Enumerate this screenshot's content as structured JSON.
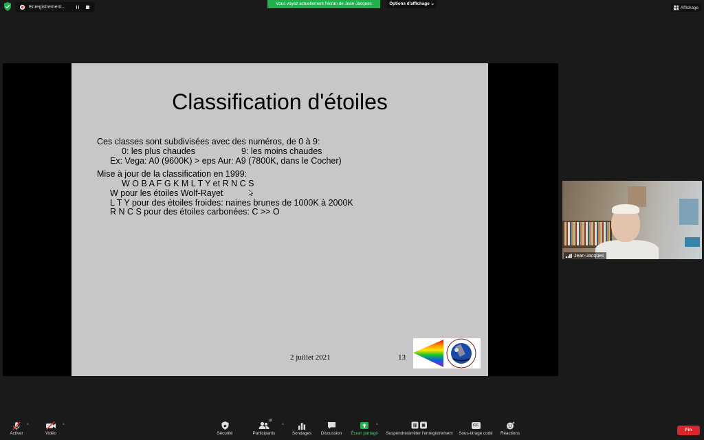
{
  "top_bar": {
    "recording_label": "Enregistrement...",
    "share_banner": "Vous voyez actuellement l'écran de Jean-Jacques",
    "view_options": "Options d'affichage",
    "view_options_caret": "⌄",
    "display_button": "Affichage"
  },
  "slide": {
    "title": "Classification d'étoiles",
    "lines": [
      "Ces classes sont subdivisées avec des numéros, de 0 à 9:",
      "0:  les plus chaudes",
      "9:  les moins chaudes",
      "Ex: Vega: A0 (9600K) > eps Aur: A9 (7800K, dans le Cocher)",
      "Mise à jour de la classification en 1999:",
      "W O B A F G K M L T Y   et R N C S",
      "W pour les étoiles Wolf-Rayet",
      "L T Y pour des étoiles froides: naines brunes de 1000K à 2000K",
      "R N C S pour des étoiles carbonées: C >> O"
    ],
    "date": "2 juillet 2021",
    "page_number": "13"
  },
  "participant": {
    "name": "Jean-Jacques"
  },
  "toolbar": {
    "mute": "Activer",
    "video": "Vidéo",
    "security": "Sécurité",
    "participants": "Participants",
    "participants_count": "18",
    "polls": "Sondages",
    "chat": "Discussion",
    "share_screen": "Écran partagé",
    "record": "Suspendre/arrêter l'enregistrement",
    "captions": "Sous-titrage codé",
    "captions_icon_text": "CC",
    "reactions": "Réactions",
    "end": "Fin",
    "caret": "^"
  },
  "colors": {
    "share_banner": "#22b14c",
    "end_button": "#d9272e",
    "slide_bg": "#c8c6c8",
    "share_icon": "#22b14c"
  }
}
